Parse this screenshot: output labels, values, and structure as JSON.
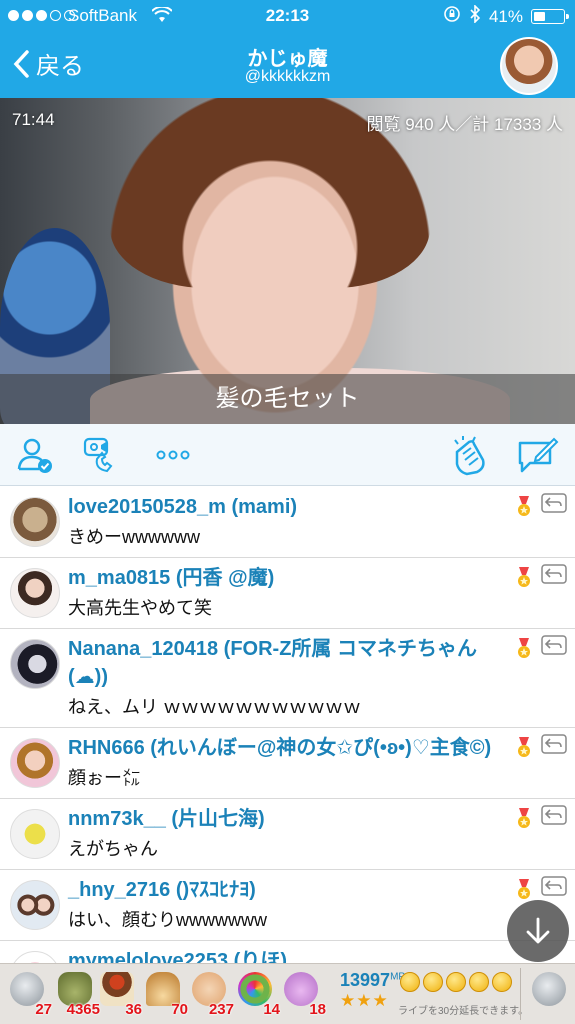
{
  "status_bar": {
    "carrier": "SoftBank",
    "time": "22:13",
    "battery": "41%",
    "battery_level": 0.41
  },
  "nav": {
    "back_label": "戻る",
    "title": "かじゅ魔",
    "handle": "@kkkkkkzm"
  },
  "video": {
    "elapsed": "71:44",
    "viewers": "閲覧 940 人／計 17333 人",
    "caption": "髪の毛セット"
  },
  "toolbar": {
    "icons": [
      "follow-user-icon",
      "collab-call-icon",
      "more-icon",
      "clap-icon",
      "comment-compose-icon"
    ]
  },
  "comments": [
    {
      "name": "love20150528_m (mami)",
      "text": "きめーwwwwww"
    },
    {
      "name": "m_ma0815 (円香 @魔)",
      "text": "大高先生やめて笑"
    },
    {
      "name": "Nanana_120418 (FOR-Z所属 コマネチちゃん(☁))",
      "text": "ねえ、ムリ ｗｗｗｗｗｗｗｗｗｗｗ"
    },
    {
      "name": "RHN666 (れいんぼー@神の女✩ぴ(•ʚ•)♡主食©)",
      "text": "顔ぉー㍍"
    },
    {
      "name": "nnm73k__ (片山七海)",
      "text": "えがちゃん"
    },
    {
      "name": "_hny_2716 ()ﾏｽｺﾋﾅﾖ)",
      "text": "はい、顔むりwwwwwww"
    },
    {
      "name": "mymelolove2253 (りほ)",
      "text": ""
    }
  ],
  "gifts": [
    {
      "icon": "stone-icon",
      "count": "27"
    },
    {
      "icon": "bag-icon",
      "count": "4365"
    },
    {
      "icon": "cake-icon",
      "count": "36"
    },
    {
      "icon": "hat-icon",
      "count": "70"
    },
    {
      "icon": "clap-gift-icon",
      "count": "237"
    },
    {
      "icon": "wreath-icon",
      "count": "14"
    },
    {
      "icon": "bear-icon",
      "count": "18"
    }
  ],
  "mp": {
    "value": "13997",
    "unit": "MP",
    "stars": "★★★",
    "coins": 5,
    "note": "ライブを30分延長できます。"
  },
  "colors": {
    "accent": "#21a8e6",
    "name": "#1b82b8",
    "count": "#e2141a"
  }
}
